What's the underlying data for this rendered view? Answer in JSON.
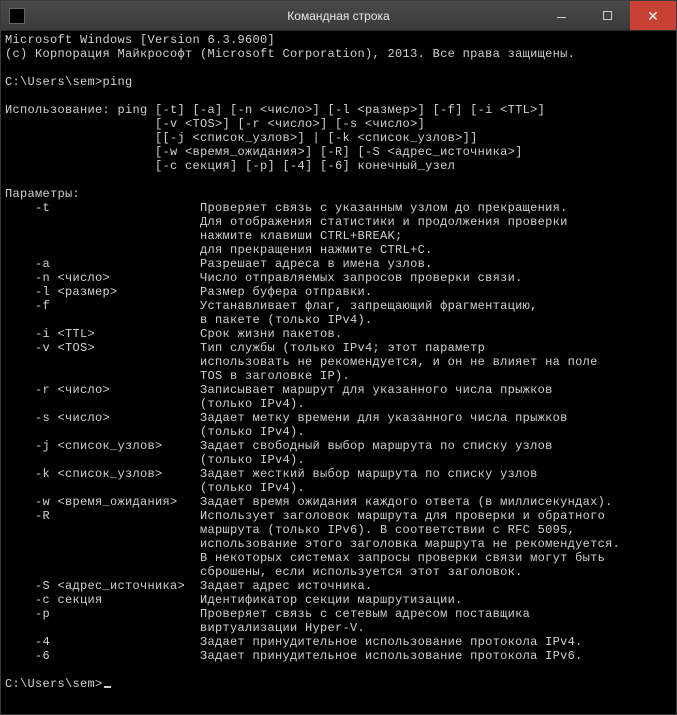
{
  "window": {
    "title": "Командная строка"
  },
  "header": {
    "line1": "Microsoft Windows [Version 6.3.9600]",
    "line2": "(c) Корпорация Майкрософт (Microsoft Corporation), 2013. Все права защищены."
  },
  "prompt1": "C:\\Users\\sem>ping",
  "usage_label": "Использование:",
  "usage_lines": [
    "ping [-t] [-a] [-n <число>] [-l <размер>] [-f] [-i <TTL>]",
    "     [-v <TOS>] [-r <число>] [-s <число>]",
    "     [[-j <список_узлов>] | [-k <список_узлов>]]",
    "     [-w <время_ожидания>] [-R] [-S <адрес_источника>]",
    "     [-c секция] [-p] [-4] [-6] конечный_узел"
  ],
  "params_label": "Параметры:",
  "params": [
    {
      "flag": "-t",
      "desc": "Проверяет связь с указанным узлом до прекращения.\nДля отображения статистики и продолжения проверки\nнажмите клавиши CTRL+BREAK;\nдля прекращения нажмите CTRL+C."
    },
    {
      "flag": "-a",
      "desc": "Разрешает адреса в имена узлов."
    },
    {
      "flag": "-n <число>",
      "desc": "Число отправляемых запросов проверки связи."
    },
    {
      "flag": "-l <размер>",
      "desc": "Размер буфера отправки."
    },
    {
      "flag": "-f",
      "desc": "Устанавливает флаг, запрещающий фрагментацию,\nв пакете (только IPv4)."
    },
    {
      "flag": "-i <TTL>",
      "desc": "Срок жизни пакетов."
    },
    {
      "flag": "-v <TOS>",
      "desc": "Тип службы (только IPv4; этот параметр\nиспользовать не рекомендуется, и он не влияет на поле\nTOS в заголовке IP)."
    },
    {
      "flag": "-r <число>",
      "desc": "Записывает маршрут для указанного числа прыжков\n(только IPv4)."
    },
    {
      "flag": "-s <число>",
      "desc": "Задает метку времени для указанного числа прыжков\n(только IPv4)."
    },
    {
      "flag": "-j <список_узлов>",
      "desc": "Задает свободный выбор маршрута по списку узлов\n(только IPv4)."
    },
    {
      "flag": "-k <список_узлов>",
      "desc": "Задает жесткий выбор маршрута по списку узлов\n(только IPv4)."
    },
    {
      "flag": "-w <время_ожидания>",
      "desc": "Задает время ожидания каждого ответа (в миллисекундах)."
    },
    {
      "flag": "-R",
      "desc": "Использует заголовок маршрута для проверки и обратного\nмаршрута (только IPv6). В соответствии с RFC 5095,\nиспользование этого заголовка маршрута не рекомендуется.\nВ некоторых системах запросы проверки связи могут быть\nсброшены, если используется этот заголовок."
    },
    {
      "flag": "-S <адрес_источника>",
      "desc": "Задает адрес источника."
    },
    {
      "flag": "-c секция",
      "desc": "Идентификатор секции маршрутизации."
    },
    {
      "flag": "-p",
      "desc": "Проверяет связь с сетевым адресом поставщика\nвиртуализации Hyper-V."
    },
    {
      "flag": "-4",
      "desc": "Задает принудительное использование протокола IPv4."
    },
    {
      "flag": "-6",
      "desc": "Задает принудительное использование протокола IPv6."
    }
  ],
  "prompt2": "C:\\Users\\sem>"
}
